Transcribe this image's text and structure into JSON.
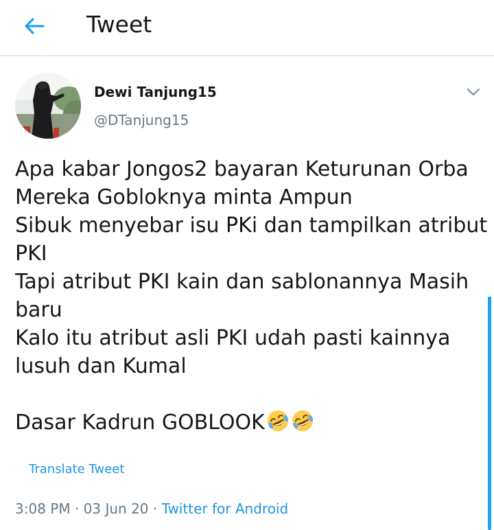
{
  "header": {
    "back_icon": "arrow-left-icon",
    "title": "Tweet"
  },
  "tweet": {
    "author_name": "Dewi Tanjung15",
    "author_handle": "@DTanjung15",
    "menu_icon": "chevron-down-icon",
    "lines": [
      "Apa kabar Jongos2 bayaran Keturunan Orba",
      "Mereka Gobloknya minta Ampun",
      "Sibuk menyebar isu PKi dan tampilkan atribut",
      "PKI",
      "Tapi atribut PKI kain dan sablonannya Masih",
      "baru",
      "Kalo itu atribut asli PKI udah pasti kainnya",
      "lusuh dan Kumal"
    ],
    "last_line": "Dasar Kadrun GOBLOOK",
    "emoji_icon": "rolling-on-floor-laughing-emoji",
    "translate_label": "Translate Tweet",
    "time": "3:08 PM",
    "date": "03 Jun 20",
    "separator": "·",
    "source": "Twitter for Android"
  },
  "colors": {
    "accent": "#1da1f2",
    "link": "#1b95e0",
    "secondary_text": "#657786",
    "divider": "#e1e8ed"
  }
}
